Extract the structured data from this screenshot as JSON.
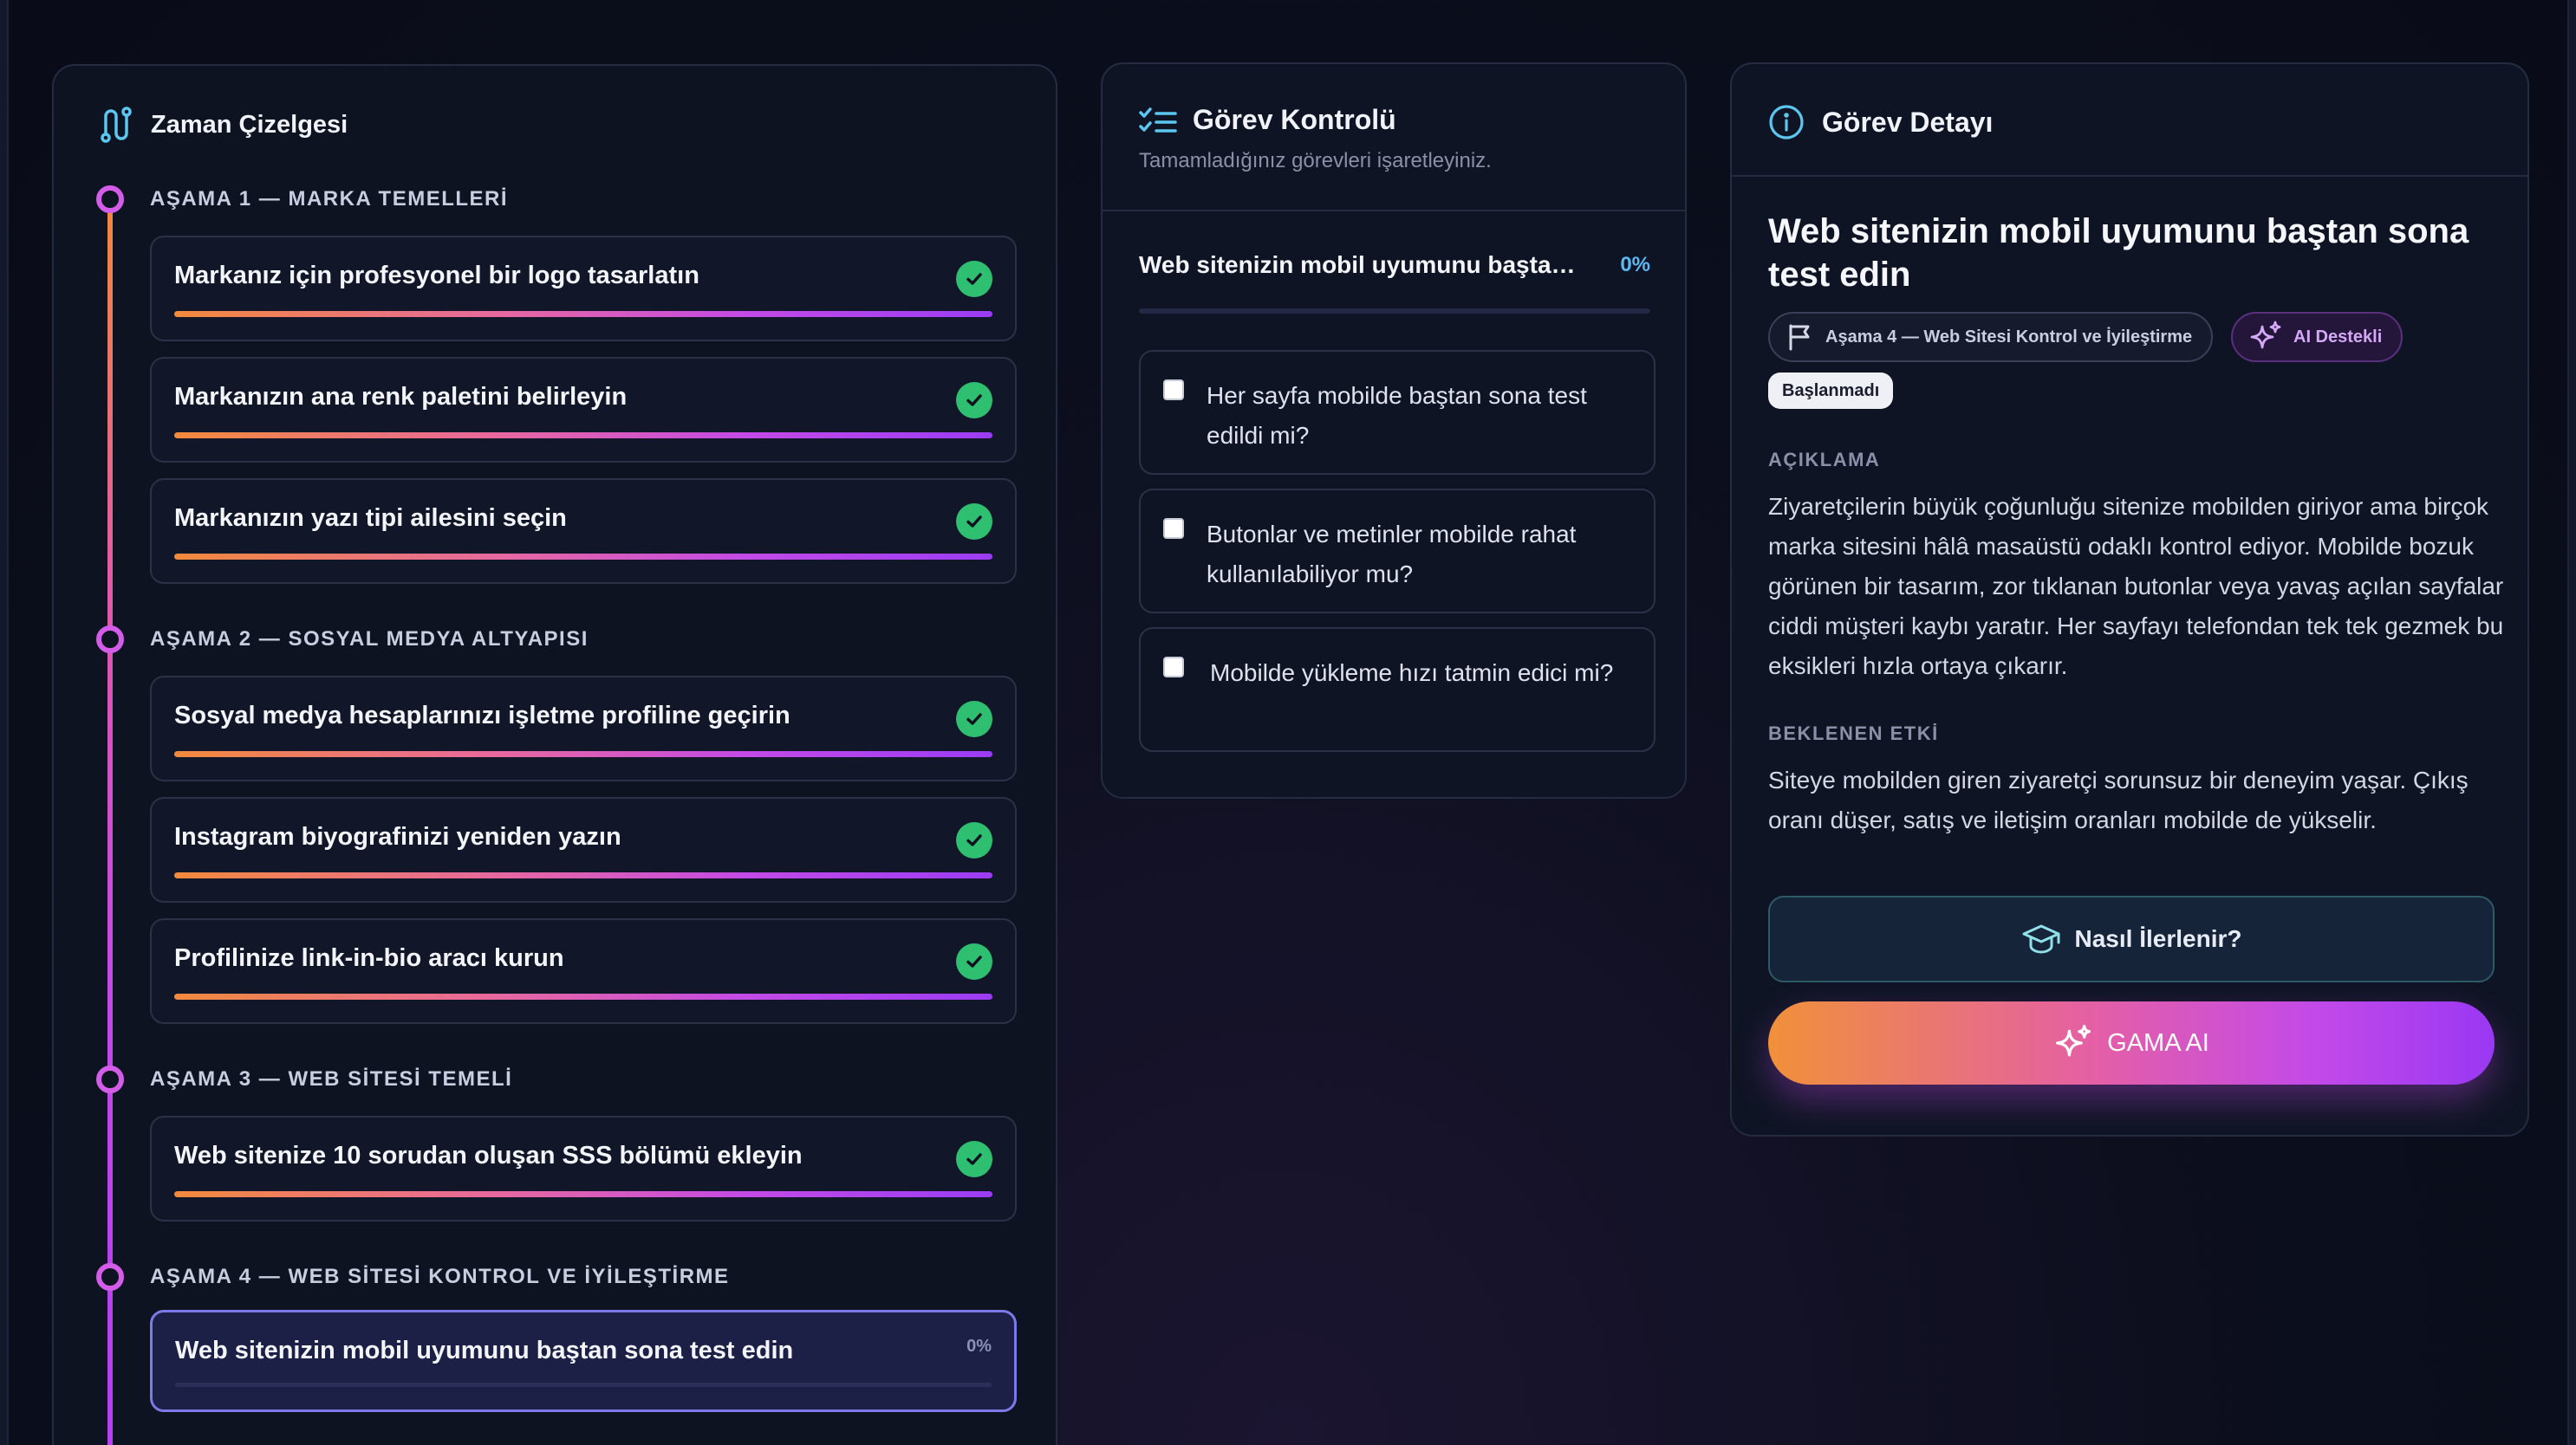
{
  "timeline": {
    "title": "Zaman Çizelgesi",
    "phases": [
      {
        "label": "AŞAMA 1 — MARKA TEMELLERİ",
        "tasks": [
          {
            "text": "Markanız için profesyonel bir logo tasarlatın",
            "completed": true
          },
          {
            "text": "Markanızın ana renk paletini belirleyin",
            "completed": true
          },
          {
            "text": "Markanızın yazı tipi ailesini seçin",
            "completed": true
          }
        ]
      },
      {
        "label": "AŞAMA 2 — SOSYAL MEDYA ALTYAPISI",
        "tasks": [
          {
            "text": "Sosyal medya hesaplarınızı işletme profiline geçirin",
            "completed": true
          },
          {
            "text": "Instagram biyografinizi yeniden yazın",
            "completed": true
          },
          {
            "text": "Profilinize link-in-bio aracı kurun",
            "completed": true
          }
        ]
      },
      {
        "label": "AŞAMA 3 — WEB SİTESİ TEMELİ",
        "tasks": [
          {
            "text": "Web sitenize 10 sorudan oluşan SSS bölümü ekleyin",
            "completed": true
          }
        ]
      },
      {
        "label": "AŞAMA 4 — WEB SİTESİ KONTROL VE İYİLEŞTİRME",
        "tasks": [
          {
            "text": "Web sitenizin mobil uyumunu baştan sona test edin",
            "completed": false,
            "progress": "0%",
            "active": true
          }
        ]
      }
    ]
  },
  "control": {
    "title": "Görev Kontrolü",
    "subtitle": "Tamamladığınız görevleri işaretleyiniz.",
    "task_title": "Web sitenizin mobil uyumunu baştan sona test edin",
    "progress": "0%",
    "checklist": [
      {
        "text": "Her sayfa mobilde baştan sona test edildi mi?",
        "checked": false
      },
      {
        "text": "Butonlar ve metinler mobilde rahat kullanılabiliyor mu?",
        "checked": false
      },
      {
        "text": "Mobilde yükleme hızı tatmin edici mi?",
        "checked": false
      }
    ]
  },
  "detail": {
    "header": "Görev Detayı",
    "task_title": "Web sitenizin mobil uyumunu baştan sona test edin",
    "phase_badge": "Aşama 4 — Web Sitesi Kontrol ve İyileştirme",
    "ai_badge": "AI Destekli",
    "status": "Başlanmadı",
    "description_label": "AÇIKLAMA",
    "description": "Ziyaretçilerin büyük çoğunluğu sitenize mobilden giriyor ama birçok marka sitesini hâlâ masaüstü odaklı kontrol ediyor. Mobilde bozuk görünen bir tasarım, zor tıklanan butonlar veya yavaş açılan sayfalar ciddi müşteri kaybı yaratır. Her sayfayı telefondan tek tek gezmek bu eksikleri hızla ortaya çıkarır.",
    "impact_label": "BEKLENEN ETKİ",
    "impact": "Siteye mobilden giren ziyaretçi sorunsuz bir deneyim yaşar. Çıkış oranı düşer, satış ve iletişim oranları mobilde de yükselir.",
    "how_button": "Nasıl İlerlenir?",
    "ai_button": "GAMA AI"
  },
  "colors": {
    "accent_gradient_start": "#f28a3c",
    "accent_gradient_end": "#9b3cf5",
    "success": "#2fbf71",
    "progress_text": "#5bb8f2",
    "panel_bg": "#0f1424"
  },
  "icons": {
    "timeline": "route-icon",
    "control": "checklist-icon",
    "detail": "info-icon",
    "check": "check-circle-icon",
    "phase": "flag-icon",
    "ai": "sparkles-icon",
    "how": "graduation-cap-icon"
  }
}
